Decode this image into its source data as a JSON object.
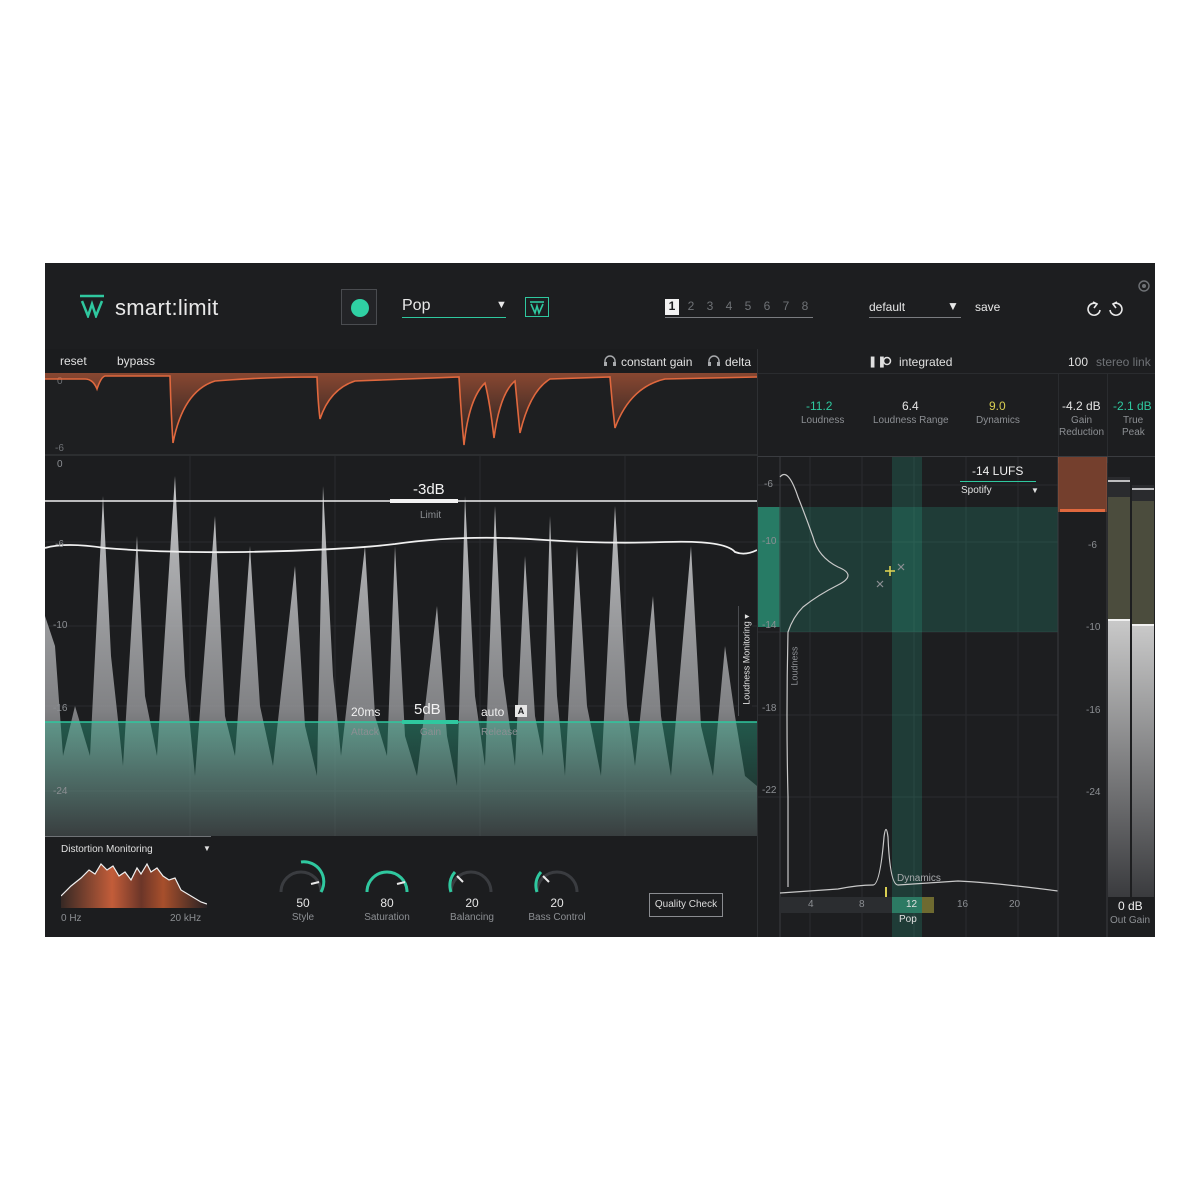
{
  "header": {
    "product_name": "smart:limit",
    "logo_icon": "sonible-logo-icon",
    "profile": "Pop",
    "slots": [
      "1",
      "2",
      "3",
      "4",
      "5",
      "6",
      "7",
      "8"
    ],
    "active_slot": "1",
    "preset": "default",
    "save_label": "save"
  },
  "toolbar": {
    "reset_label": "reset",
    "bypass_label": "bypass",
    "constant_gain_label": "constant gain",
    "delta_label": "delta",
    "integrated_label": "integrated",
    "stereo_link_value": "100",
    "stereo_link_label": "stereo link"
  },
  "gr_scale": {
    "top": "0",
    "bottom": "-6"
  },
  "main_scale": [
    "0",
    "-6",
    "-10",
    "-16",
    "-24"
  ],
  "limit": {
    "value": "-3dB",
    "label": "Limit"
  },
  "attack": {
    "value": "20ms",
    "label": "Attack"
  },
  "gain": {
    "value": "5dB",
    "label": "Gain"
  },
  "release": {
    "value": "auto",
    "label": "Release",
    "badge": "A"
  },
  "loudness_monitoring_label": "Loudness Monitoring ▾",
  "distortion": {
    "label": "Distortion Monitoring",
    "min_freq": "0 Hz",
    "max_freq": "20 kHz"
  },
  "knobs": [
    {
      "value": "50",
      "label": "Style",
      "level": 0.5
    },
    {
      "value": "80",
      "label": "Saturation",
      "level": 0.8
    },
    {
      "value": "20",
      "label": "Balancing",
      "level": 0.2
    },
    {
      "value": "20",
      "label": "Bass Control",
      "level": 0.2
    }
  ],
  "quality_check_label": "Quality Check",
  "meters": {
    "loudness": {
      "value": "-11.2",
      "label": "Loudness"
    },
    "loudness_range": {
      "value": "6.4",
      "label": "Loudness Range"
    },
    "dynamics": {
      "value": "9.0",
      "label": "Dynamics"
    },
    "gain_reduction": {
      "value": "-4.2 dB",
      "label_1": "Gain",
      "label_2": "Reduction"
    },
    "true_peak": {
      "value": "-2.1 dB",
      "label_1": "True",
      "label_2": "Peak"
    }
  },
  "target": {
    "value": "-14 LUFS",
    "platform": "Spotify"
  },
  "right_scale": [
    "-6",
    "-10",
    "-14",
    "-18",
    "-22"
  ],
  "meter_scale": [
    "-6",
    "-10",
    "-16",
    "-24"
  ],
  "loudness_axis_label": "Loudness",
  "dynamics_axis_label": "Dynamics",
  "dynamics_scale": [
    "4",
    "8",
    "12",
    "16",
    "20"
  ],
  "genre_label": "Pop",
  "out_gain": {
    "value": "0 dB",
    "label": "Out Gain"
  },
  "colors": {
    "accent": "#2fc89f",
    "gain_reduction": "#e0683e",
    "target_yellow": "#d9cf52",
    "background": "#1b1c1e"
  }
}
